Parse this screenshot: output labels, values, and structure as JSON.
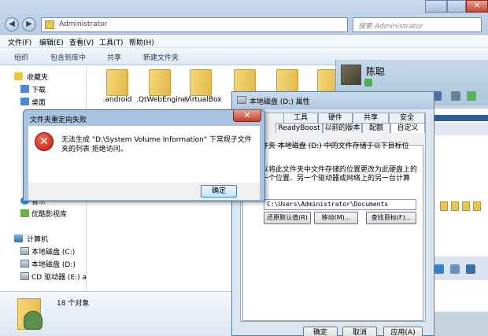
{
  "explorer": {
    "address": "Administrator",
    "search_placeholder": "搜索 Administrator",
    "menu": [
      "文件(F)",
      "编辑(E)",
      "查看(V)",
      "工具(T)",
      "帮助(H)"
    ],
    "toolbar": [
      "组织",
      "包含到库中",
      "共享",
      "新建文件夹"
    ],
    "nav": {
      "favorites": "收藏夹",
      "downloads": "下载",
      "desktop": "桌面",
      "music": "音乐",
      "youku": "优酷影视库",
      "computer": "计算机",
      "drive_c": "本地磁盘 (C:)",
      "drive_d": "本地磁盘 (D:)",
      "drive_e": "CD 驱动器 (E:) a"
    },
    "folders": [
      ".android",
      ".QtWebEngineProce",
      ".VirtualBox",
      "",
      ""
    ],
    "status_count": "18 个对象"
  },
  "chat": {
    "contact_name": "陈聪"
  },
  "properties": {
    "title": "本地磁盘 (D:) 属性",
    "tabs_row1": [
      "工具",
      "硬件",
      "共享",
      "安全"
    ],
    "tabs_row2": [
      "ReadyBoost",
      "以前的版本",
      "配额",
      "自定义"
    ],
    "desc1": "文件夹 本地磁盘 (D:) 中的文件存储于以下目标位置。",
    "desc2": "可以将此文件夹中文件存储的位置更改为此硬盘上的另一个位置、另一个驱动器或网络上的另一台计算机。",
    "path": "C:\\Users\\Administrator\\Documents",
    "btn_restore": "还原默认值(R)",
    "btn_move": "移动(M)...",
    "btn_find": "查找目标(F)...",
    "btn_ok": "确定",
    "btn_cancel": "取消",
    "btn_apply": "应用(A)"
  },
  "error": {
    "title": "文件夹重定向失败",
    "message": "无法生成 \"D:\\System Volume Information\" 下常规子文件夹的列表 拒绝访问。",
    "ok": "确定"
  }
}
